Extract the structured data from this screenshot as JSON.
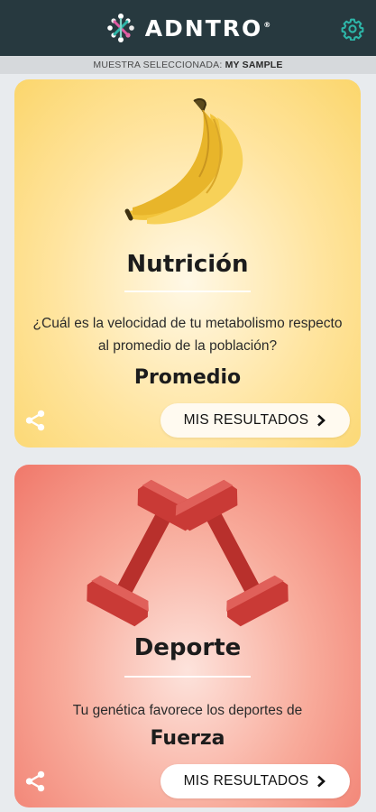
{
  "header": {
    "brand": "ADNTRO",
    "brand_mark_symbol": "®",
    "logo_icon": "adntro-dna-logo-icon",
    "settings_icon": "gear-icon",
    "background": "#27393f",
    "accent": "#2db5a8"
  },
  "sample": {
    "label": "MUESTRA SELECCIONADA:",
    "value": "MY SAMPLE"
  },
  "cards": [
    {
      "title": "Nutrición",
      "question": "¿Cuál es la velocidad de tu metabolismo respecto al promedio de la población?",
      "answer": "Promedio",
      "button": "MIS RESULTADOS",
      "image": "bananas",
      "color": "#fbd66c"
    },
    {
      "title": "Deporte",
      "question": "Tu genética favorece los deportes de",
      "answer": "Fuerza",
      "button": "MIS RESULTADOS",
      "image": "red-dumbbells",
      "color": "#f0786a"
    }
  ]
}
